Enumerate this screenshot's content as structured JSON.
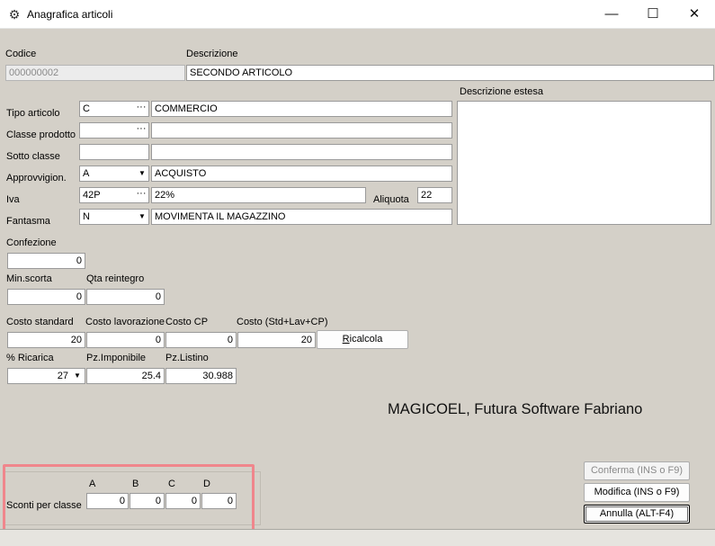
{
  "window": {
    "title": "Anagrafica articoli",
    "icon": "gear-icon",
    "minimize_glyph": "—",
    "maximize_glyph": "☐",
    "close_glyph": "✕"
  },
  "codice": {
    "label": "Codice",
    "value": "000000002"
  },
  "descrizione": {
    "label": "Descrizione",
    "value": "SECONDO ARTICOLO"
  },
  "descrizione_estesa": {
    "label": "Descrizione estesa",
    "value": ""
  },
  "tipo_articolo": {
    "label": "Tipo articolo",
    "code": "C",
    "desc": "COMMERCIO"
  },
  "classe_prodotto": {
    "label": "Classe prodotto",
    "code": "",
    "desc": ""
  },
  "sotto_classe": {
    "label": "Sotto classe",
    "code": "",
    "desc": ""
  },
  "approvvigion": {
    "label": "Approvvigion.",
    "code": "A",
    "desc": "ACQUISTO"
  },
  "iva": {
    "label": "Iva",
    "code": "42P",
    "desc": "22%",
    "aliquota_label": "Aliquota",
    "aliquota": "22"
  },
  "fantasma": {
    "label": "Fantasma",
    "code": "N",
    "desc": "MOVIMENTA IL MAGAZZINO"
  },
  "confezione": {
    "label": "Confezione",
    "value": "0"
  },
  "min_scorta": {
    "label": "Min.scorta",
    "value": "0"
  },
  "qta_reintegro": {
    "label": "Qta reintegro",
    "value": "0"
  },
  "costi": {
    "standard_label": "Costo standard",
    "standard": "20",
    "lavorazione_label": "Costo lavorazione",
    "lavorazione": "0",
    "cp_label": "Costo CP",
    "cp": "0",
    "totale_label": "Costo (Std+Lav+CP)",
    "totale": "20",
    "ricalcola_label": "Ricalcola"
  },
  "prezzi": {
    "ricarica_label": "% Ricarica",
    "ricarica": "27",
    "imponibile_label": "Pz.Imponibile",
    "imponibile": "25.4",
    "listino_label": "Pz.Listino",
    "listino": "30.988"
  },
  "brand": "MAGICOEL, Futura Software Fabriano",
  "sconti": {
    "label": "Sconti per classe",
    "headers": [
      "A",
      "B",
      "C",
      "D"
    ],
    "values": [
      "0",
      "0",
      "0",
      "0"
    ]
  },
  "buttons": {
    "conferma": "Conferma  (INS o F9)",
    "modifica": "Modifica (INS o F9)",
    "annulla": "Annulla  (ALT-F4)"
  },
  "colors": {
    "form_bg": "#d4d0c8",
    "highlight": "#f0868c"
  }
}
